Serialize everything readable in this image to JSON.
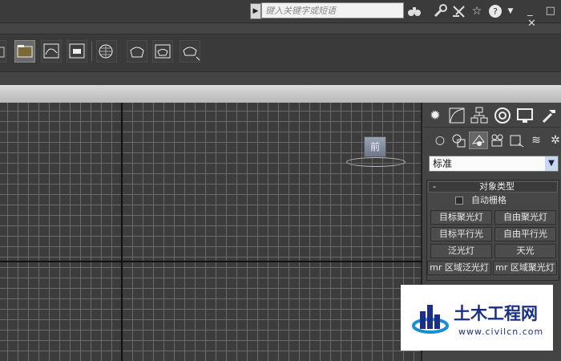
{
  "search": {
    "placeholder": "键入关键字或短语"
  },
  "top_icons": [
    "binoculars-icon",
    "wrench-icon",
    "tools-icon",
    "star-icon",
    "help-icon"
  ],
  "window_controls": "_ □ ✕",
  "viewport": {
    "object_label": "前"
  },
  "panel": {
    "dropdown_value": "标准",
    "rollout_minus": "-",
    "rollout_title": "对象类型",
    "autogrid_label": "自动栅格",
    "buttons": [
      "目标聚光灯",
      "自由聚光灯",
      "目标平行光",
      "自由平行光",
      "泛光灯",
      "天光",
      "mr 区域泛光灯",
      "mr 区域聚光灯"
    ]
  },
  "watermark": {
    "title": "土木工程网",
    "url": "www.civilcn.com"
  },
  "colors": {
    "accent": "#1b2f86",
    "viewport_bg": "#3c3c3c",
    "grid": "#6a6a6a"
  }
}
